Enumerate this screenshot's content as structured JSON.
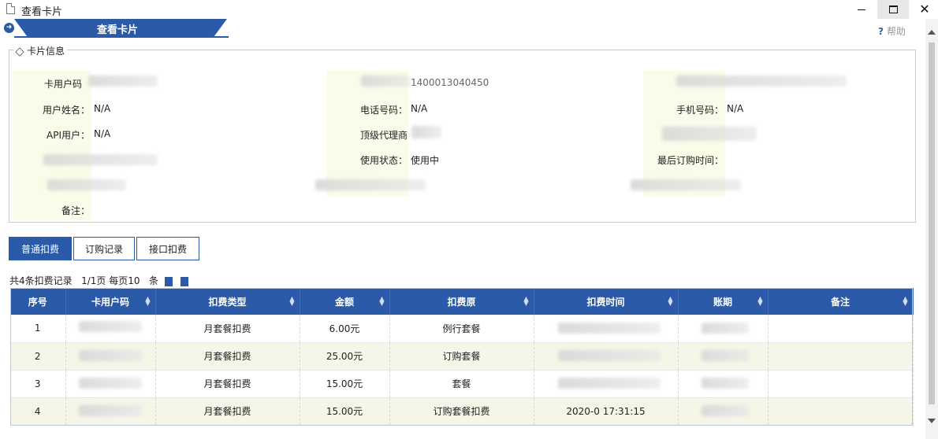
{
  "window": {
    "title": "查看卡片"
  },
  "header": {
    "tab_title": "查看卡片",
    "help_label": "帮助"
  },
  "card_info": {
    "legend": "卡片信息",
    "fields": [
      {
        "label": "卡用户码",
        "value": ""
      },
      {
        "label": "",
        "value": "1400013040450"
      },
      {
        "label": "",
        "value": ""
      },
      {
        "label": "用户姓名：",
        "value": "N/A"
      },
      {
        "label": "电话号码：",
        "value": "N/A"
      },
      {
        "label": "手机号码：",
        "value": "N/A"
      },
      {
        "label": "API用户：",
        "value": "N/A"
      },
      {
        "label": "顶级代理商",
        "value": ""
      },
      {
        "label": "",
        "value": ""
      },
      {
        "label": "",
        "value": ""
      },
      {
        "label": "使用状态：",
        "value": "使用中"
      },
      {
        "label": "最后订购时间：",
        "value": ""
      },
      {
        "label": "",
        "value": ""
      },
      {
        "label": "",
        "value": ""
      },
      {
        "label": "",
        "value": ""
      },
      {
        "label": "备注：",
        "value": ""
      }
    ]
  },
  "subtabs": [
    {
      "label": "普通扣费",
      "active": true
    },
    {
      "label": "订购记录",
      "active": false
    },
    {
      "label": "接口扣费",
      "active": false
    }
  ],
  "summary": {
    "count_text": "共4条扣费记录",
    "page_text": "1/1页 每页10",
    "unit": "条"
  },
  "table": {
    "columns": [
      "序号",
      "卡用户码",
      "扣费类型",
      "金额",
      "扣费原",
      "扣费时间",
      "账期",
      "备注"
    ],
    "rows": [
      {
        "no": "1",
        "code": "",
        "type": "月套餐扣费",
        "amount": "6.00元",
        "reason": "例行套餐",
        "time": "",
        "period": "",
        "note": ""
      },
      {
        "no": "2",
        "code": "",
        "type": "月套餐扣费",
        "amount": "25.00元",
        "reason": "订购套餐",
        "time": "",
        "period": "",
        "note": ""
      },
      {
        "no": "3",
        "code": "",
        "type": "月套餐扣费",
        "amount": "15.00元",
        "reason": "套餐",
        "time": "",
        "period": "",
        "note": ""
      },
      {
        "no": "4",
        "code": "",
        "type": "月套餐扣费",
        "amount": "15.00元",
        "reason": "订购套餐扣费",
        "time": "2020-0 17:31:15",
        "period": "",
        "note": ""
      }
    ]
  }
}
